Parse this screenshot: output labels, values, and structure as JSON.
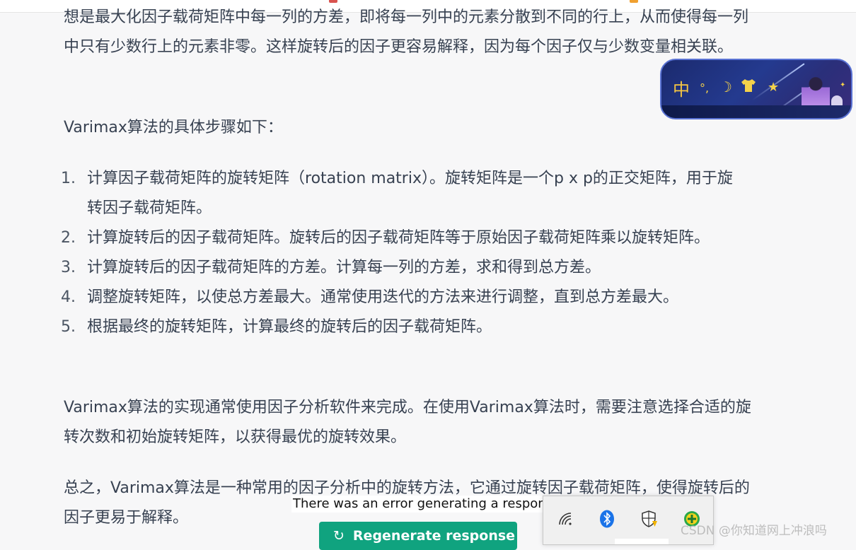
{
  "article": {
    "intro": "想是最大化因子载荷矩阵中每一列的方差，即将每一列中的元素分散到不同的行上，从而使得每一列中只有少数行上的元素非零。这样旋转后的因子更容易解释，因为每个因子仅与少数变量相关联。",
    "steps_heading": "Varimax算法的具体步骤如下：",
    "steps": [
      {
        "num": "1.",
        "text": "计算因子载荷矩阵的旋转矩阵（rotation matrix）。旋转矩阵是一个p x p的正交矩阵，用于旋转因子载荷矩阵。"
      },
      {
        "num": "2.",
        "text": "计算旋转后的因子载荷矩阵。旋转后的因子载荷矩阵等于原始因子载荷矩阵乘以旋转矩阵。"
      },
      {
        "num": "3.",
        "text": "计算旋转后的因子载荷矩阵的方差。计算每一列的方差，求和得到总方差。"
      },
      {
        "num": "4.",
        "text": "调整旋转矩阵，以使总方差最大。通常使用迭代的方法来进行调整，直到总方差最大。"
      },
      {
        "num": "5.",
        "text": "根据最终的旋转矩阵，计算最终的旋转后的因子载荷矩阵。"
      }
    ],
    "implementation": "Varimax算法的实现通常使用因子分析软件来完成。在使用Varimax算法时，需要注意选择合适的旋转次数和初始旋转矩阵，以获得最优的旋转效果。",
    "summary": "总之，Varimax算法是一种常用的因子分析中的旋转方法，它通过旋转因子载荷矩阵，使得旋转后的因子更易于解释。"
  },
  "ime": {
    "mode_char": "中",
    "icons": [
      "punctuation-icon",
      "moon-icon",
      "shirt-icon",
      "star-icon"
    ]
  },
  "status": {
    "error_message": "There was an error generating a response",
    "regenerate_label": "Regenerate response"
  },
  "tray": {
    "icons": [
      "wifi-icon",
      "bluetooth-icon",
      "security-shield-icon",
      "plus-app-icon"
    ]
  },
  "watermark": "CSDN @你知道网上冲浪吗",
  "colors": {
    "background": "#f7f7f8",
    "text": "#374151",
    "regenerate_button": "#10a37f"
  }
}
